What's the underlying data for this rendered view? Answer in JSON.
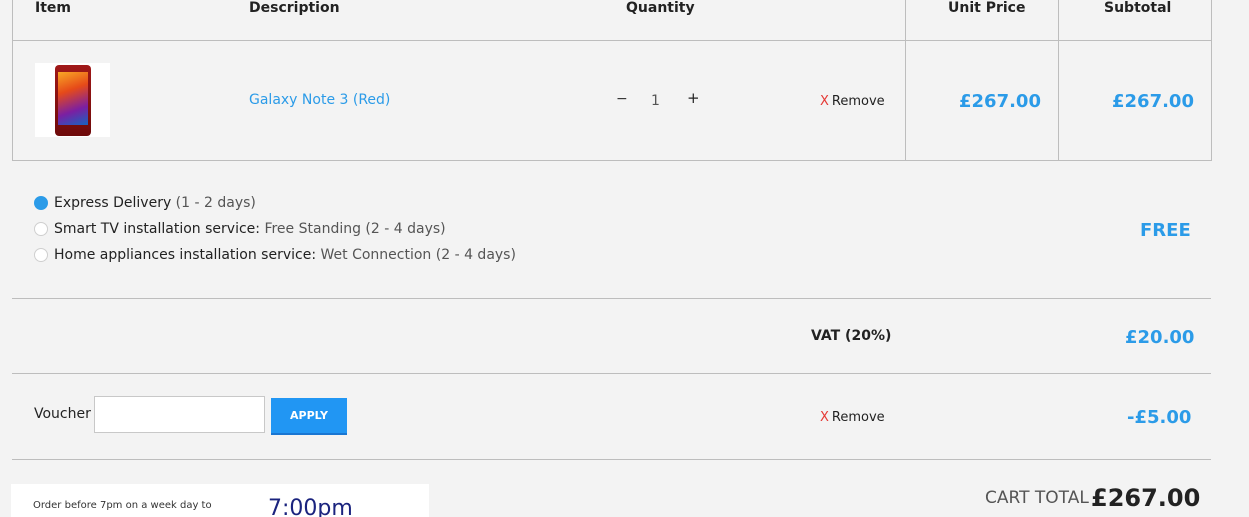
{
  "table_header": {
    "item": "Item",
    "description": "Description",
    "quantity": "Quantity",
    "unit_price": "Unit Price",
    "subtotal": "Subtotal"
  },
  "product": {
    "name": "Galaxy Note 3 (Red)",
    "quantity": "1",
    "decrement": "−",
    "increment": "+",
    "remove_x": "X",
    "remove_label": "Remove",
    "unit_price": "£267.00",
    "subtotal": "£267.00"
  },
  "delivery": {
    "options": [
      {
        "title": "Express Delivery",
        "detail": " (1 - 2 days)",
        "selected": true
      },
      {
        "title": "Smart TV installation service:",
        "detail": " Free Standing (2 - 4 days)",
        "selected": false
      },
      {
        "title": "Home appliances installation service:",
        "detail": " Wet Connection (2 - 4 days)",
        "selected": false
      }
    ],
    "price": "FREE"
  },
  "vat": {
    "label": "VAT (20%)",
    "value": "£20.00"
  },
  "voucher": {
    "label": "Voucher",
    "input_value": "",
    "apply_label": "APPLY",
    "remove_x": "X",
    "remove_label": "Remove",
    "value": "-£5.00"
  },
  "cart_total": {
    "label": "CART TOTAL",
    "value": "£267.00"
  },
  "order_notice": {
    "text": "Order before 7pm on a week day to",
    "time": "7:00pm"
  },
  "colors": {
    "accent": "#2b9be8",
    "remove_x": "#e53935",
    "background": "#f3f3f3"
  }
}
